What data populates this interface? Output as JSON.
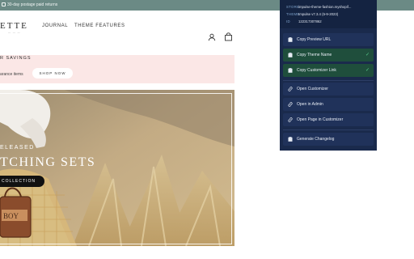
{
  "announcement": {
    "text": "30-day postage paid returns"
  },
  "header": {
    "logo": "ETTE",
    "nav": [
      {
        "label": "JOURNAL"
      },
      {
        "label": "THEME FEATURES"
      }
    ]
  },
  "promo": {
    "title": "R SAVINGS",
    "text": "arance items",
    "button": "SHOP NOW"
  },
  "hero": {
    "eyebrow": "ELEASED",
    "title": "TCHING SETS",
    "button": "COLLECTION"
  },
  "extension": {
    "info": [
      {
        "key": "STORE",
        "value": "impulse-theme-fashion.myshopif..."
      },
      {
        "key": "THEME",
        "value": "Impulse v7.3.4 (5-9-2023)"
      },
      {
        "key": "ID",
        "value": "122317307862"
      }
    ],
    "buttons": [
      {
        "label": "Copy Preview URL",
        "icon": "clipboard-icon",
        "active": false
      },
      {
        "label": "Copy Theme Name",
        "icon": "clipboard-icon",
        "active": true,
        "check": "✓"
      },
      {
        "label": "Copy Customizer Link",
        "icon": "clipboard-icon",
        "active": true,
        "check": "✓"
      },
      {
        "label": "Open Customizer",
        "icon": "link-icon",
        "active": false
      },
      {
        "label": "Open in Admin",
        "icon": "link-icon",
        "active": false
      },
      {
        "label": "Open Page in Customizer",
        "icon": "link-icon",
        "active": false
      },
      {
        "label": "Generate Changelog",
        "icon": "clipboard-icon",
        "active": false
      }
    ]
  },
  "colors": {
    "announcement_bg": "#6b8a85",
    "promo_bg": "#fbe7e6",
    "popup_bg": "#1a2a4c",
    "active_bg": "#1f4e3c",
    "check": "#58c98a"
  }
}
